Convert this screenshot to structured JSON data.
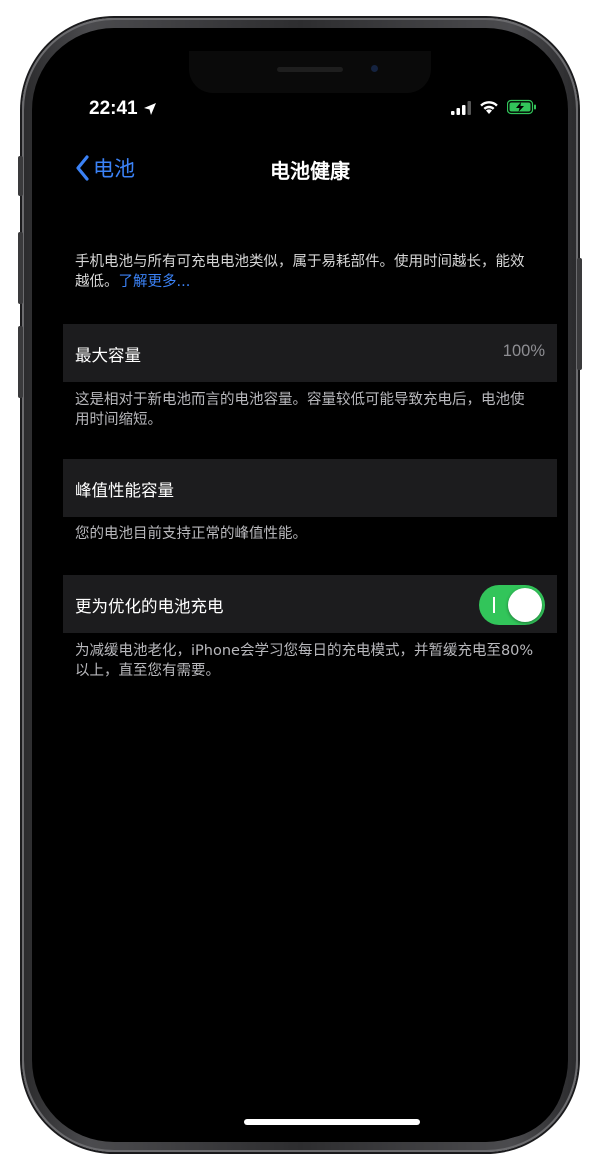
{
  "status_bar": {
    "time": "22:41",
    "icons": [
      "location-arrow-icon",
      "cellular-signal-icon",
      "wifi-icon",
      "battery-charging-icon"
    ],
    "battery_color": "#32c55a"
  },
  "navbar": {
    "back_label": "电池",
    "title": "电池健康"
  },
  "intro": {
    "text": "手机电池与所有可充电电池类似，属于易耗部件。使用时间越长，能效越低。",
    "link": "了解更多..."
  },
  "max_capacity": {
    "label": "最大容量",
    "value": "100%",
    "footnote": "这是相对于新电池而言的电池容量。容量较低可能导致充电后，电池使用时间缩短。"
  },
  "peak_performance": {
    "label": "峰值性能容量",
    "footnote": "您的电池目前支持正常的峰值性能。"
  },
  "optimized_charging": {
    "label": "更为优化的电池充电",
    "enabled": true,
    "footnote": "为减缓电池老化，iPhone会学习您每日的充电模式，并暂缓充电至80%以上，直至您有需要。"
  },
  "colors": {
    "accent": "#3b82f6",
    "toggle_on": "#32c55a",
    "cell_bg": "#1c1c1e"
  }
}
